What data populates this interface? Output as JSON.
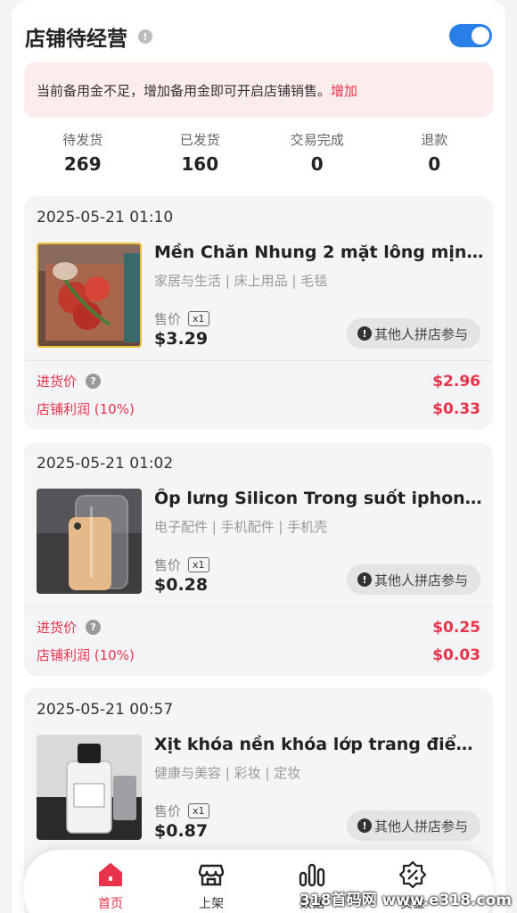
{
  "header": {
    "title": "店铺待经营",
    "info_icon": "info-icon",
    "toggle_on": true
  },
  "alert": {
    "text": "当前备用金不足，增加备用金即可开启店铺销售。",
    "link": "增加"
  },
  "stats": [
    {
      "label": "待发货",
      "value": "269"
    },
    {
      "label": "已发货",
      "value": "160"
    },
    {
      "label": "交易完成",
      "value": "0"
    },
    {
      "label": "退款",
      "value": "0"
    }
  ],
  "orders": [
    {
      "date": "2025-05-21 01:10",
      "title": "Mền Chăn Nhung 2 mặt lông mịn C...",
      "category": "家居与生活 | 床上用品 | 毛毯",
      "price_label": "售价",
      "qty": "x1",
      "price": "$3.29",
      "group_button": "其他人拼店参与",
      "cost_label": "进货价",
      "cost": "$2.96",
      "profit_label": "店铺利润 (10%)",
      "profit": "$0.33"
    },
    {
      "date": "2025-05-21 01:02",
      "title": "Ốp lưng Silicon Trong suốt iphone...",
      "category": "电子配件 | 手机配件 | 手机壳",
      "price_label": "售价",
      "qty": "x1",
      "price": "$0.28",
      "group_button": "其他人拼店参与",
      "cost_label": "进货价",
      "cost": "$0.25",
      "profit_label": "店铺利润 (10%)",
      "profit": "$0.03"
    },
    {
      "date": "2025-05-21 00:57",
      "title": "Xịt khóa nền khóa lớp trang điểm d...",
      "category": "健康与美容 | 彩妆 | 定妆",
      "price_label": "售价",
      "qty": "x1",
      "price": "$0.87",
      "group_button": "其他人拼店参与"
    }
  ],
  "tabs": [
    {
      "label": "首页",
      "icon": "home-icon",
      "active": true
    },
    {
      "label": "上架",
      "icon": "store-icon",
      "active": false
    },
    {
      "label": "数据",
      "icon": "bar-chart-icon",
      "active": false
    },
    {
      "label": "资金",
      "icon": "discount-badge-icon",
      "active": false
    }
  ],
  "watermark": "318首码网 www.e318.com",
  "colors": {
    "accent": "#e8334a",
    "toggle": "#2a7ee8"
  }
}
